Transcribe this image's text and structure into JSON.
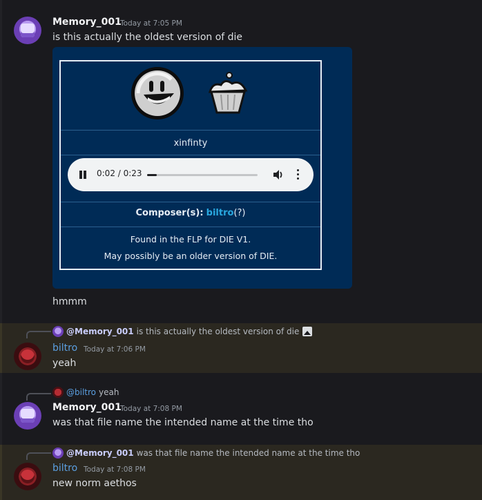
{
  "colors": {
    "background": "#1a1a1e",
    "highlight": "#2b2820",
    "embed": "#002b56",
    "link": "#29a8e0",
    "username_blue": "#5b9fe0"
  },
  "messages": [
    {
      "author": "Memory_001",
      "time": "Today at 7:05 PM",
      "text": "is this actually the oldest version of die",
      "avatar": "purple-cat-avatar"
    },
    {
      "text": "hmmm"
    },
    {
      "reply": {
        "author": "@Memory_001",
        "text": "is this actually the oldest version of die",
        "icon": "image-icon"
      },
      "author": "biltro",
      "time": "Today at 7:06 PM",
      "text": "yeah",
      "avatar": "red-avatar"
    },
    {
      "reply": {
        "author": "@biltro",
        "text": "yeah"
      },
      "author": "Memory_001",
      "time": "Today at 7:08 PM",
      "text": "was that file name the intended name at the time tho",
      "avatar": "purple-cat-avatar"
    },
    {
      "reply": {
        "author": "@Memory_001",
        "text": "was that file name the intended name at the time tho"
      },
      "author": "biltro",
      "time": "Today at 7:08 PM",
      "text": "new norm aethos",
      "avatar": "red-avatar"
    }
  ],
  "embed": {
    "artist": "xinfinty",
    "player": {
      "time": "0:02 / 0:23",
      "progress": 0.09
    },
    "composer_label": "Composer(s):",
    "composer_name": "biltro",
    "composer_suffix": "(?)",
    "note_line1": "Found in the FLP for DIE V1.",
    "note_line2": "May possibly be an older version of DIE."
  }
}
